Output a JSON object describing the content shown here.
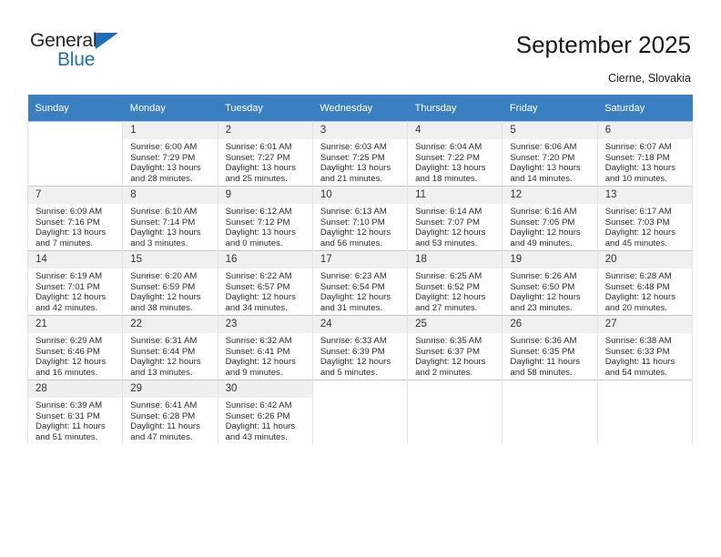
{
  "brand": {
    "name_top": "General",
    "name_bottom": "Blue",
    "triangle_color": "#1d70b7"
  },
  "header": {
    "title": "September 2025",
    "subtitle": "Cierne, Slovakia"
  },
  "theme": {
    "header_row_color": "#3a7fc1",
    "daynum_background": "#f0f0f0",
    "text_color": "#2b2b2b"
  },
  "calendar": {
    "weekdays": [
      "Sunday",
      "Monday",
      "Tuesday",
      "Wednesday",
      "Thursday",
      "Friday",
      "Saturday"
    ],
    "weeks": [
      [
        {
          "day": "",
          "blank": true
        },
        {
          "day": "1",
          "sunrise": "Sunrise: 6:00 AM",
          "sunset": "Sunset: 7:29 PM",
          "daylight_1": "Daylight: 13 hours",
          "daylight_2": "and 28 minutes."
        },
        {
          "day": "2",
          "sunrise": "Sunrise: 6:01 AM",
          "sunset": "Sunset: 7:27 PM",
          "daylight_1": "Daylight: 13 hours",
          "daylight_2": "and 25 minutes."
        },
        {
          "day": "3",
          "sunrise": "Sunrise: 6:03 AM",
          "sunset": "Sunset: 7:25 PM",
          "daylight_1": "Daylight: 13 hours",
          "daylight_2": "and 21 minutes."
        },
        {
          "day": "4",
          "sunrise": "Sunrise: 6:04 AM",
          "sunset": "Sunset: 7:22 PM",
          "daylight_1": "Daylight: 13 hours",
          "daylight_2": "and 18 minutes."
        },
        {
          "day": "5",
          "sunrise": "Sunrise: 6:06 AM",
          "sunset": "Sunset: 7:20 PM",
          "daylight_1": "Daylight: 13 hours",
          "daylight_2": "and 14 minutes."
        },
        {
          "day": "6",
          "sunrise": "Sunrise: 6:07 AM",
          "sunset": "Sunset: 7:18 PM",
          "daylight_1": "Daylight: 13 hours",
          "daylight_2": "and 10 minutes."
        }
      ],
      [
        {
          "day": "7",
          "sunrise": "Sunrise: 6:09 AM",
          "sunset": "Sunset: 7:16 PM",
          "daylight_1": "Daylight: 13 hours",
          "daylight_2": "and 7 minutes."
        },
        {
          "day": "8",
          "sunrise": "Sunrise: 6:10 AM",
          "sunset": "Sunset: 7:14 PM",
          "daylight_1": "Daylight: 13 hours",
          "daylight_2": "and 3 minutes."
        },
        {
          "day": "9",
          "sunrise": "Sunrise: 6:12 AM",
          "sunset": "Sunset: 7:12 PM",
          "daylight_1": "Daylight: 13 hours",
          "daylight_2": "and 0 minutes."
        },
        {
          "day": "10",
          "sunrise": "Sunrise: 6:13 AM",
          "sunset": "Sunset: 7:10 PM",
          "daylight_1": "Daylight: 12 hours",
          "daylight_2": "and 56 minutes."
        },
        {
          "day": "11",
          "sunrise": "Sunrise: 6:14 AM",
          "sunset": "Sunset: 7:07 PM",
          "daylight_1": "Daylight: 12 hours",
          "daylight_2": "and 53 minutes."
        },
        {
          "day": "12",
          "sunrise": "Sunrise: 6:16 AM",
          "sunset": "Sunset: 7:05 PM",
          "daylight_1": "Daylight: 12 hours",
          "daylight_2": "and 49 minutes."
        },
        {
          "day": "13",
          "sunrise": "Sunrise: 6:17 AM",
          "sunset": "Sunset: 7:03 PM",
          "daylight_1": "Daylight: 12 hours",
          "daylight_2": "and 45 minutes."
        }
      ],
      [
        {
          "day": "14",
          "sunrise": "Sunrise: 6:19 AM",
          "sunset": "Sunset: 7:01 PM",
          "daylight_1": "Daylight: 12 hours",
          "daylight_2": "and 42 minutes."
        },
        {
          "day": "15",
          "sunrise": "Sunrise: 6:20 AM",
          "sunset": "Sunset: 6:59 PM",
          "daylight_1": "Daylight: 12 hours",
          "daylight_2": "and 38 minutes."
        },
        {
          "day": "16",
          "sunrise": "Sunrise: 6:22 AM",
          "sunset": "Sunset: 6:57 PM",
          "daylight_1": "Daylight: 12 hours",
          "daylight_2": "and 34 minutes."
        },
        {
          "day": "17",
          "sunrise": "Sunrise: 6:23 AM",
          "sunset": "Sunset: 6:54 PM",
          "daylight_1": "Daylight: 12 hours",
          "daylight_2": "and 31 minutes."
        },
        {
          "day": "18",
          "sunrise": "Sunrise: 6:25 AM",
          "sunset": "Sunset: 6:52 PM",
          "daylight_1": "Daylight: 12 hours",
          "daylight_2": "and 27 minutes."
        },
        {
          "day": "19",
          "sunrise": "Sunrise: 6:26 AM",
          "sunset": "Sunset: 6:50 PM",
          "daylight_1": "Daylight: 12 hours",
          "daylight_2": "and 23 minutes."
        },
        {
          "day": "20",
          "sunrise": "Sunrise: 6:28 AM",
          "sunset": "Sunset: 6:48 PM",
          "daylight_1": "Daylight: 12 hours",
          "daylight_2": "and 20 minutes."
        }
      ],
      [
        {
          "day": "21",
          "sunrise": "Sunrise: 6:29 AM",
          "sunset": "Sunset: 6:46 PM",
          "daylight_1": "Daylight: 12 hours",
          "daylight_2": "and 16 minutes."
        },
        {
          "day": "22",
          "sunrise": "Sunrise: 6:31 AM",
          "sunset": "Sunset: 6:44 PM",
          "daylight_1": "Daylight: 12 hours",
          "daylight_2": "and 13 minutes."
        },
        {
          "day": "23",
          "sunrise": "Sunrise: 6:32 AM",
          "sunset": "Sunset: 6:41 PM",
          "daylight_1": "Daylight: 12 hours",
          "daylight_2": "and 9 minutes."
        },
        {
          "day": "24",
          "sunrise": "Sunrise: 6:33 AM",
          "sunset": "Sunset: 6:39 PM",
          "daylight_1": "Daylight: 12 hours",
          "daylight_2": "and 5 minutes."
        },
        {
          "day": "25",
          "sunrise": "Sunrise: 6:35 AM",
          "sunset": "Sunset: 6:37 PM",
          "daylight_1": "Daylight: 12 hours",
          "daylight_2": "and 2 minutes."
        },
        {
          "day": "26",
          "sunrise": "Sunrise: 6:36 AM",
          "sunset": "Sunset: 6:35 PM",
          "daylight_1": "Daylight: 11 hours",
          "daylight_2": "and 58 minutes."
        },
        {
          "day": "27",
          "sunrise": "Sunrise: 6:38 AM",
          "sunset": "Sunset: 6:33 PM",
          "daylight_1": "Daylight: 11 hours",
          "daylight_2": "and 54 minutes."
        }
      ],
      [
        {
          "day": "28",
          "sunrise": "Sunrise: 6:39 AM",
          "sunset": "Sunset: 6:31 PM",
          "daylight_1": "Daylight: 11 hours",
          "daylight_2": "and 51 minutes."
        },
        {
          "day": "29",
          "sunrise": "Sunrise: 6:41 AM",
          "sunset": "Sunset: 6:28 PM",
          "daylight_1": "Daylight: 11 hours",
          "daylight_2": "and 47 minutes."
        },
        {
          "day": "30",
          "sunrise": "Sunrise: 6:42 AM",
          "sunset": "Sunset: 6:26 PM",
          "daylight_1": "Daylight: 11 hours",
          "daylight_2": "and 43 minutes."
        },
        {
          "day": "",
          "blank": true
        },
        {
          "day": "",
          "blank": true
        },
        {
          "day": "",
          "blank": true
        },
        {
          "day": "",
          "blank": true
        }
      ]
    ]
  }
}
